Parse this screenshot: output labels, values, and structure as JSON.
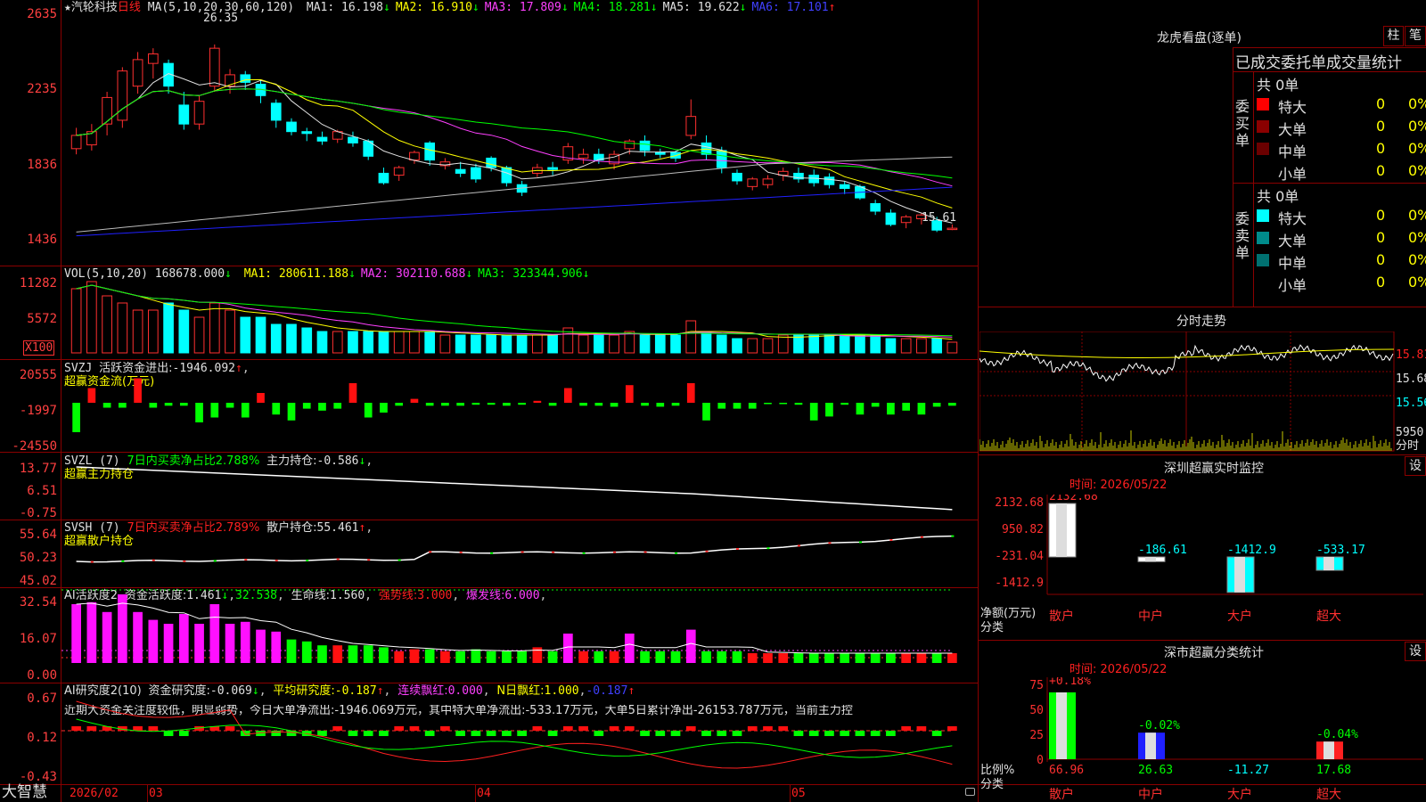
{
  "stock": {
    "name": "汽轮科技",
    "period": "日线",
    "star": "★"
  },
  "main_panel": {
    "ma_label": "MA(5,10,20,30,60,120)",
    "ma": [
      {
        "name": "MA1",
        "value": "16.198",
        "dir": "↓",
        "color": "#e0e0e0"
      },
      {
        "name": "MA2",
        "value": "16.910",
        "dir": "↓",
        "color": "#ffff00"
      },
      {
        "name": "MA3",
        "value": "17.809",
        "dir": "↓",
        "color": "#ff40ff"
      },
      {
        "name": "MA4",
        "value": "18.281",
        "dir": "↓",
        "color": "#00ff00"
      },
      {
        "name": "MA5",
        "value": "19.622",
        "dir": "↓",
        "color": "#e0e0e0"
      },
      {
        "name": "MA6",
        "value": "17.101",
        "dir": "↑",
        "color": "#4040ff"
      }
    ],
    "high_mark": "26.35",
    "low_mark": "15.61",
    "yaxis": [
      "2635",
      "2235",
      "1836",
      "1436"
    ]
  },
  "vol_panel": {
    "label": "VOL(5,10,20)",
    "value": "168678.000",
    "dir": "↓",
    "ma": [
      {
        "name": "MA1",
        "value": "280611.188",
        "dir": "↓",
        "color": "#ffff00"
      },
      {
        "name": "MA2",
        "value": "302110.688",
        "dir": "↓",
        "color": "#ff40ff"
      },
      {
        "name": "MA3",
        "value": "323344.906",
        "dir": "↓",
        "color": "#00ff00"
      }
    ],
    "yaxis": [
      "11282",
      "5572",
      "X100"
    ]
  },
  "svzj_panel": {
    "label": "SVZJ",
    "title": "活跃资金进出:",
    "value": "-1946.092",
    "dir": "↑",
    "sub": "超赢资金流(万元)",
    "yaxis": [
      "20555",
      "-1997",
      "-24550"
    ]
  },
  "svzl_panel": {
    "label": "SVZL (7)",
    "pct": "7日内买卖净占比2.788%",
    "title": "主力持仓:",
    "value": "-0.586",
    "dir": "↓",
    "sub": "超赢主力持仓",
    "yaxis": [
      "13.77",
      "6.51",
      "-0.75"
    ]
  },
  "svsh_panel": {
    "label": "SVSH (7)",
    "pct": "7日内买卖净占比2.789%",
    "title": "散户持仓:",
    "value": "55.461",
    "dir": "↑",
    "sub": "超赢散户持仓",
    "yaxis": [
      "55.64",
      "50.23",
      "45.02"
    ]
  },
  "ai_active": {
    "label": "AI活跃度2",
    "title": "资金活跃度:",
    "value": "1.461",
    "dir": "↓",
    "v2": "32.538",
    "life_label": "生命线:",
    "life": "1.560",
    "strong_label": "强势线:",
    "strong": "3.000",
    "burst_label": "爆发线:",
    "burst": "6.000",
    "yaxis": [
      "32.54",
      "16.07",
      "0.00"
    ]
  },
  "ai_research": {
    "label": "AI研究度2(10)",
    "title": "资金研究度:",
    "value": "-0.069",
    "dir": "↓",
    "avg_label": "平均研究度:",
    "avg": "-0.187",
    "avg_dir": "↑",
    "red_label": "连续飘红:",
    "red": "0.000",
    "nred_label": "N日飘红:",
    "nred": "1.000",
    "last": "-0.187",
    "last_dir": "↑",
    "note": "近期大资金关注度较低，明显弱势，今日大单净流出:-1946.069万元，其中特大单净流出:-533.17万元，大单5日累计净出-26153.787万元，当前主力控",
    "yaxis": [
      "0.67",
      "0.12",
      "-0.43"
    ]
  },
  "xaxis": {
    "labels": [
      "2026/02",
      "03",
      "04",
      "05"
    ],
    "brand": "大智慧"
  },
  "right": {
    "dragon_title": "龙虎看盘(逐单)",
    "btn1": "柱",
    "btn2": "笔",
    "stat_title": "已成交委托单成交量统计",
    "buy": {
      "side": "委买单",
      "total": "共 0单",
      "rows": [
        {
          "name": "特大",
          "v": "0",
          "p": "0%",
          "color": "#ff0000"
        },
        {
          "name": "大单",
          "v": "0",
          "p": "0%",
          "color": "#8b0000"
        },
        {
          "name": "中单",
          "v": "0",
          "p": "0%",
          "color": "#6b0000"
        },
        {
          "name": "小单",
          "v": "0",
          "p": "0%",
          "color": "#000000"
        }
      ]
    },
    "sell": {
      "side": "委卖单",
      "total": "共 0单",
      "rows": [
        {
          "name": "特大",
          "v": "0",
          "p": "0%",
          "color": "#00ffff"
        },
        {
          "name": "大单",
          "v": "0",
          "p": "0%",
          "color": "#008b8b"
        },
        {
          "name": "中单",
          "v": "0",
          "p": "0%",
          "color": "#007070"
        },
        {
          "name": "小单",
          "v": "0",
          "p": "0%",
          "color": "#000000"
        }
      ]
    },
    "intraday_title": "分时走势",
    "intraday_axis": [
      "15.81",
      "15.68",
      "15.56"
    ],
    "intraday_vol": "5950",
    "intraday_vol_label": "分时",
    "sz_title": "深圳超赢实时监控",
    "set": "设",
    "sz_time": "时间: 2026/05/22",
    "sz_axis": [
      "2132.68",
      "950.82",
      "-231.04",
      "-1412.9"
    ],
    "sz_net": "净额(万元)",
    "sz_cls": "分类",
    "sz_bars": [
      {
        "cat": "散户",
        "value": 2132.68,
        "label": "2132.68",
        "color": "#ffffff",
        "tcolor": "#ff3030"
      },
      {
        "cat": "中户",
        "value": -186.61,
        "label": "-186.61",
        "color": "#ffffff",
        "tcolor": "#00ffff"
      },
      {
        "cat": "大户",
        "value": -1412.9,
        "label": "-1412.9",
        "color": "#00ffff",
        "tcolor": "#00ffff"
      },
      {
        "cat": "超大",
        "value": -533.17,
        "label": "-533.17",
        "color": "#00ffff",
        "tcolor": "#00ffff"
      }
    ],
    "sm_title": "深市超赢分类统计",
    "sm_time": "时间: 2026/05/22",
    "sm_axis": [
      "75",
      "50",
      "25",
      "0"
    ],
    "sm_ratio": "比例%",
    "sm_cls": "分类",
    "sm_bars": [
      {
        "cat": "散户",
        "value": 66.96,
        "label": "66.96",
        "top": "+0.18%",
        "color": "#00ff00",
        "tcolor": "#ff3030"
      },
      {
        "cat": "中户",
        "value": 26.63,
        "label": "26.63",
        "top": "-0.02%",
        "color": "#2020ff",
        "tcolor": "#00ff00"
      },
      {
        "cat": "大户",
        "value": -11.27,
        "label": "-11.27",
        "top": "",
        "color": "#00ffff",
        "tcolor": "#00ffff"
      },
      {
        "cat": "超大",
        "value": 17.68,
        "label": "17.68",
        "top": "-0.04%",
        "color": "#ff2020",
        "tcolor": "#00ff00"
      }
    ]
  },
  "chart_data": {
    "type": "candlestick",
    "title": "汽轮科技 日线",
    "ylim": [
      14.36,
      26.35
    ],
    "candles": [
      {
        "o": 19.9,
        "c": 20.6,
        "h": 21.0,
        "l": 19.6
      },
      {
        "o": 20.1,
        "c": 20.8,
        "h": 21.2,
        "l": 19.8
      },
      {
        "o": 21.2,
        "c": 22.6,
        "h": 22.9,
        "l": 20.6
      },
      {
        "o": 21.4,
        "c": 24.0,
        "h": 24.2,
        "l": 21.0
      },
      {
        "o": 23.2,
        "c": 24.6,
        "h": 25.0,
        "l": 22.8
      },
      {
        "o": 24.4,
        "c": 24.9,
        "h": 25.2,
        "l": 23.6
      },
      {
        "o": 24.4,
        "c": 23.2,
        "h": 24.6,
        "l": 22.8
      },
      {
        "o": 22.2,
        "c": 21.2,
        "h": 22.9,
        "l": 20.9
      },
      {
        "o": 21.2,
        "c": 22.4,
        "h": 22.7,
        "l": 20.9
      },
      {
        "o": 23.2,
        "c": 25.2,
        "h": 25.4,
        "l": 22.9
      },
      {
        "o": 23.2,
        "c": 23.8,
        "h": 24.1,
        "l": 22.8
      },
      {
        "o": 23.8,
        "c": 23.4,
        "h": 24.0,
        "l": 23.0
      },
      {
        "o": 23.3,
        "c": 22.7,
        "h": 23.5,
        "l": 22.3
      },
      {
        "o": 22.3,
        "c": 21.4,
        "h": 22.5,
        "l": 21.0
      },
      {
        "o": 21.3,
        "c": 20.8,
        "h": 21.5,
        "l": 20.6
      },
      {
        "o": 20.8,
        "c": 20.7,
        "h": 21.0,
        "l": 20.3
      },
      {
        "o": 20.5,
        "c": 20.3,
        "h": 20.8,
        "l": 20.1
      },
      {
        "o": 20.4,
        "c": 20.8,
        "h": 20.9,
        "l": 20.2
      },
      {
        "o": 20.5,
        "c": 20.2,
        "h": 20.8,
        "l": 20.0
      },
      {
        "o": 20.3,
        "c": 19.5,
        "h": 20.4,
        "l": 19.3
      },
      {
        "o": 18.6,
        "c": 18.1,
        "h": 18.9,
        "l": 18.0
      },
      {
        "o": 18.5,
        "c": 18.9,
        "h": 19.0,
        "l": 18.2
      },
      {
        "o": 19.3,
        "c": 19.7,
        "h": 19.8,
        "l": 19.1
      },
      {
        "o": 20.2,
        "c": 19.3,
        "h": 20.3,
        "l": 19.0
      },
      {
        "o": 19.0,
        "c": 19.2,
        "h": 19.4,
        "l": 18.8
      },
      {
        "o": 18.8,
        "c": 18.6,
        "h": 19.2,
        "l": 18.4
      },
      {
        "o": 18.9,
        "c": 18.3,
        "h": 19.1,
        "l": 18.1
      },
      {
        "o": 19.4,
        "c": 18.9,
        "h": 19.5,
        "l": 18.7
      },
      {
        "o": 18.9,
        "c": 18.1,
        "h": 19.0,
        "l": 17.9
      },
      {
        "o": 18.0,
        "c": 17.6,
        "h": 18.2,
        "l": 17.4
      },
      {
        "o": 18.6,
        "c": 18.9,
        "h": 19.1,
        "l": 18.4
      },
      {
        "o": 18.9,
        "c": 18.8,
        "h": 19.2,
        "l": 18.5
      },
      {
        "o": 19.3,
        "c": 20.0,
        "h": 20.2,
        "l": 19.1
      },
      {
        "o": 19.4,
        "c": 19.6,
        "h": 19.9,
        "l": 19.1
      },
      {
        "o": 19.6,
        "c": 19.3,
        "h": 19.9,
        "l": 19.1
      },
      {
        "o": 19.1,
        "c": 19.6,
        "h": 19.8,
        "l": 18.8
      },
      {
        "o": 19.9,
        "c": 20.3,
        "h": 20.4,
        "l": 19.6
      },
      {
        "o": 20.3,
        "c": 19.8,
        "h": 20.6,
        "l": 19.5
      },
      {
        "o": 19.7,
        "c": 19.6,
        "h": 19.9,
        "l": 19.4
      },
      {
        "o": 19.7,
        "c": 19.4,
        "h": 19.8,
        "l": 19.2
      },
      {
        "o": 20.6,
        "c": 21.6,
        "h": 22.5,
        "l": 20.4
      },
      {
        "o": 20.2,
        "c": 19.6,
        "h": 20.6,
        "l": 19.3
      },
      {
        "o": 19.8,
        "c": 18.9,
        "h": 20.0,
        "l": 18.6
      },
      {
        "o": 18.6,
        "c": 18.2,
        "h": 18.8,
        "l": 18.0
      },
      {
        "o": 17.9,
        "c": 18.3,
        "h": 18.4,
        "l": 17.7
      },
      {
        "o": 18.0,
        "c": 18.3,
        "h": 18.5,
        "l": 17.8
      },
      {
        "o": 18.5,
        "c": 18.7,
        "h": 18.9,
        "l": 18.2
      },
      {
        "o": 18.6,
        "c": 18.3,
        "h": 18.9,
        "l": 18.1
      },
      {
        "o": 18.5,
        "c": 18.1,
        "h": 18.8,
        "l": 17.9
      },
      {
        "o": 18.4,
        "c": 18.0,
        "h": 18.6,
        "l": 17.8
      },
      {
        "o": 18.0,
        "c": 17.8,
        "h": 18.2,
        "l": 17.5
      },
      {
        "o": 17.9,
        "c": 17.3,
        "h": 18.0,
        "l": 17.2
      },
      {
        "o": 17.0,
        "c": 16.6,
        "h": 17.2,
        "l": 16.4
      },
      {
        "o": 16.5,
        "c": 15.9,
        "h": 16.7,
        "l": 15.8
      },
      {
        "o": 16.0,
        "c": 16.3,
        "h": 16.4,
        "l": 15.7
      },
      {
        "o": 16.2,
        "c": 16.4,
        "h": 16.5,
        "l": 15.9
      },
      {
        "o": 16.1,
        "c": 15.6,
        "h": 16.3,
        "l": 15.5
      },
      {
        "o": 15.7,
        "c": 15.7,
        "h": 15.9,
        "l": 15.6
      }
    ]
  }
}
